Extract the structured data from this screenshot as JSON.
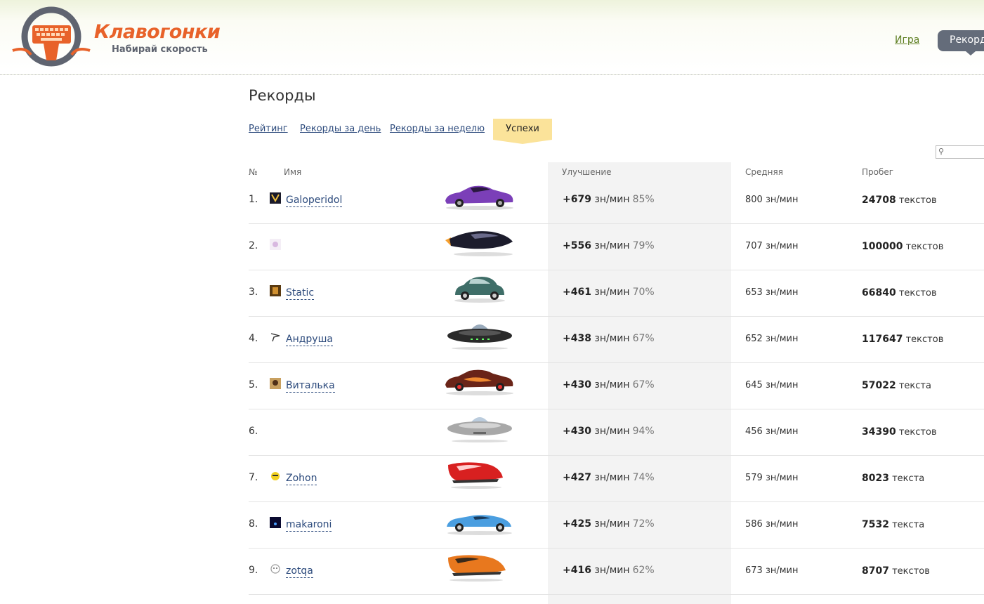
{
  "header": {
    "logo_title": "Клавогонки",
    "logo_subtitle": "Набирай скорость",
    "nav": {
      "game": "Игра",
      "records": "Рекорды"
    }
  },
  "page": {
    "title": "Рекорды",
    "tabs": [
      {
        "label": "Рейтинг"
      },
      {
        "label": "Рекорды за день"
      },
      {
        "label": "Рекорды за неделю"
      },
      {
        "label": "Успехи",
        "active": true
      }
    ]
  },
  "table": {
    "headers": {
      "rank": "№",
      "name": "Имя",
      "improvement": "Улучшение",
      "average": "Средняя",
      "distance": "Пробег"
    },
    "rows": [
      {
        "rank": "1.",
        "name": "Galoperidol",
        "car": "purple-sports-car",
        "improve": "+679",
        "unit": "зн/мин",
        "pct": "85%",
        "avg": "800 зн/мин",
        "dist_num": "24708",
        "dist_word": "текстов"
      },
      {
        "rank": "2.",
        "name": "",
        "car": "black-rocket-car",
        "improve": "+556",
        "unit": "зн/мин",
        "pct": "79%",
        "avg": "707 зн/мин",
        "dist_num": "100000",
        "dist_word": "текстов"
      },
      {
        "rank": "3.",
        "name": "Static",
        "car": "green-beetle-car",
        "improve": "+461",
        "unit": "зн/мин",
        "pct": "70%",
        "avg": "653 зн/мин",
        "dist_num": "66840",
        "dist_word": "текстов"
      },
      {
        "rank": "4.",
        "name": "Андруша",
        "car": "black-ufo",
        "improve": "+438",
        "unit": "зн/мин",
        "pct": "67%",
        "avg": "652 зн/мин",
        "dist_num": "117647",
        "dist_word": "текстов"
      },
      {
        "rank": "5.",
        "name": "Виталька",
        "car": "flame-sports-car",
        "improve": "+430",
        "unit": "зн/мин",
        "pct": "67%",
        "avg": "645 зн/мин",
        "dist_num": "57022",
        "dist_word": "текста"
      },
      {
        "rank": "6.",
        "name": "",
        "car": "silver-ufo",
        "improve": "+430",
        "unit": "зн/мин",
        "pct": "94%",
        "avg": "456 зн/мин",
        "dist_num": "34390",
        "dist_word": "текстов"
      },
      {
        "rank": "7.",
        "name": "Zohon",
        "car": "red-hover-car",
        "improve": "+427",
        "unit": "зн/мин",
        "pct": "74%",
        "avg": "579 зн/мин",
        "dist_num": "8023",
        "dist_word": "текста"
      },
      {
        "rank": "8.",
        "name": "makaroni",
        "car": "blue-roadster-car",
        "improve": "+425",
        "unit": "зн/мин",
        "pct": "72%",
        "avg": "586 зн/мин",
        "dist_num": "7532",
        "dist_word": "текста"
      },
      {
        "rank": "9.",
        "name": "zotqa",
        "car": "orange-hover-car",
        "improve": "+416",
        "unit": "зн/мин",
        "pct": "62%",
        "avg": "673 зн/мин",
        "dist_num": "8707",
        "dist_word": "текстов"
      }
    ]
  },
  "colors": {
    "brand": "#e8622a",
    "link": "#2c4a7c",
    "nav_link": "#5e7f22",
    "active_tab": "#fbe39a",
    "improve_bg": "#f3f3f3"
  }
}
